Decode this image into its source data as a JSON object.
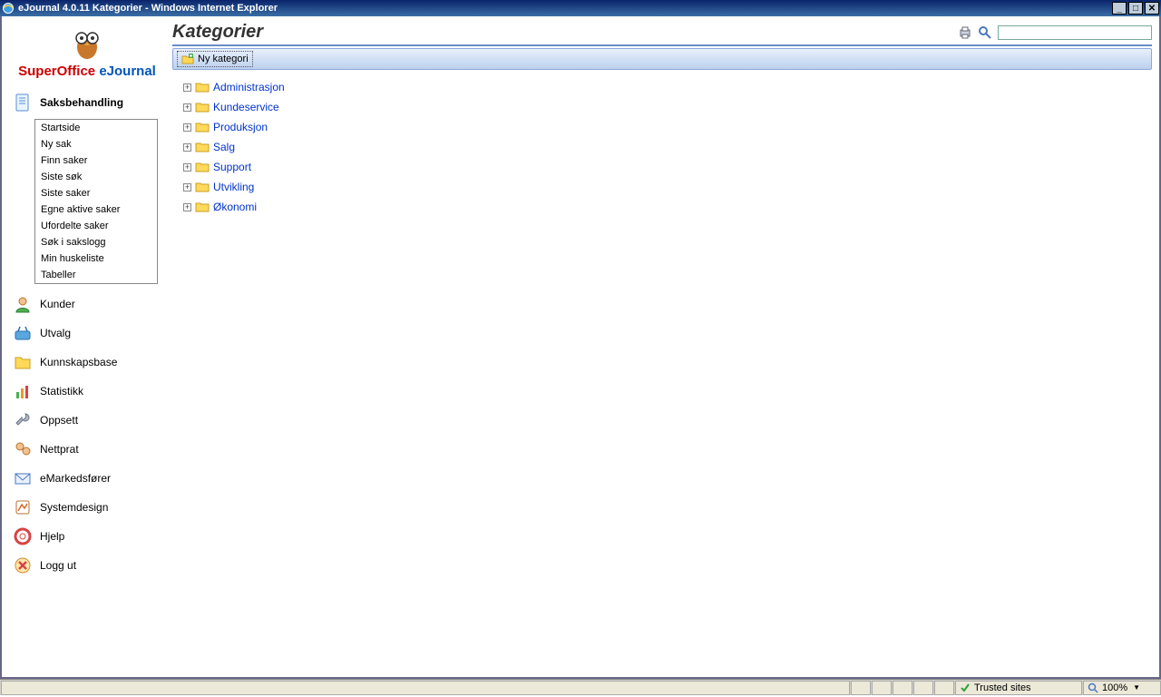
{
  "window": {
    "title": "eJournal 4.0.11 Kategorier - Windows Internet Explorer"
  },
  "logo": {
    "brand1": "SuperOffice",
    "brand2": "eJournal"
  },
  "nav": {
    "active": "Saksbehandling",
    "items": [
      {
        "label": "Saksbehandling"
      },
      {
        "label": "Kunder"
      },
      {
        "label": "Utvalg"
      },
      {
        "label": "Kunnskapsbase"
      },
      {
        "label": "Statistikk"
      },
      {
        "label": "Oppsett"
      },
      {
        "label": "Nettprat"
      },
      {
        "label": "eMarkedsfører"
      },
      {
        "label": "Systemdesign"
      },
      {
        "label": "Hjelp"
      },
      {
        "label": "Logg ut"
      }
    ],
    "submenu": [
      "Startside",
      "Ny sak",
      "Finn saker",
      "Siste søk",
      "Siste saker",
      "Egne aktive saker",
      "Ufordelte saker",
      "Søk i sakslogg",
      "Min huskeliste",
      "Tabeller"
    ]
  },
  "main": {
    "title": "Kategorier",
    "toolbar": {
      "new_category": "Ny kategori"
    },
    "search_placeholder": ""
  },
  "tree": [
    "Administrasjon",
    "Kundeservice",
    "Produksjon",
    "Salg",
    "Support",
    "Utvikling",
    "Økonomi"
  ],
  "status": {
    "trusted": "Trusted sites",
    "zoom": "100%"
  }
}
